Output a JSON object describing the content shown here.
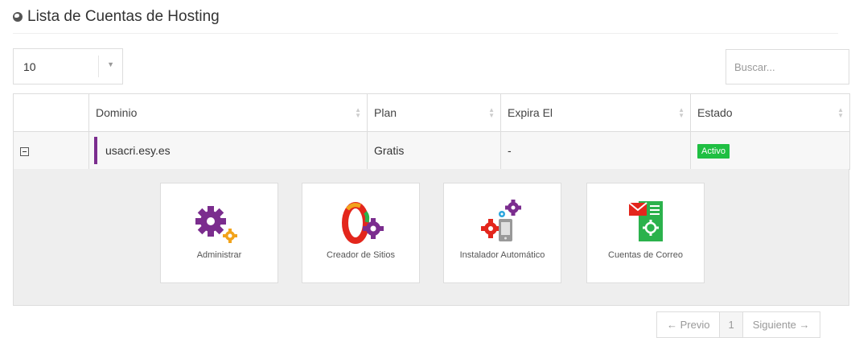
{
  "page": {
    "title": "Lista de Cuentas de Hosting"
  },
  "controls": {
    "page_length": "10",
    "search_placeholder": "Buscar..."
  },
  "table": {
    "columns": [
      "",
      "Dominio",
      "Plan",
      "Expira El",
      "Estado"
    ],
    "rows": [
      {
        "domain": "usacri.esy.es",
        "plan": "Gratis",
        "expires": "-",
        "status": "Activo"
      }
    ]
  },
  "actions": [
    {
      "label": "Administrar",
      "icon": "gears-icon"
    },
    {
      "label": "Creador de Sitios",
      "icon": "site-builder-icon"
    },
    {
      "label": "Instalador Automático",
      "icon": "auto-installer-icon"
    },
    {
      "label": "Cuentas de Correo",
      "icon": "email-accounts-icon"
    }
  ],
  "pagination": {
    "prev": "← Previo",
    "current": "1",
    "next": "Siguiente →"
  },
  "colors": {
    "accent_purple": "#7b2d8e",
    "status_green": "#1fbf42",
    "gear_orange": "#f2a31b"
  }
}
